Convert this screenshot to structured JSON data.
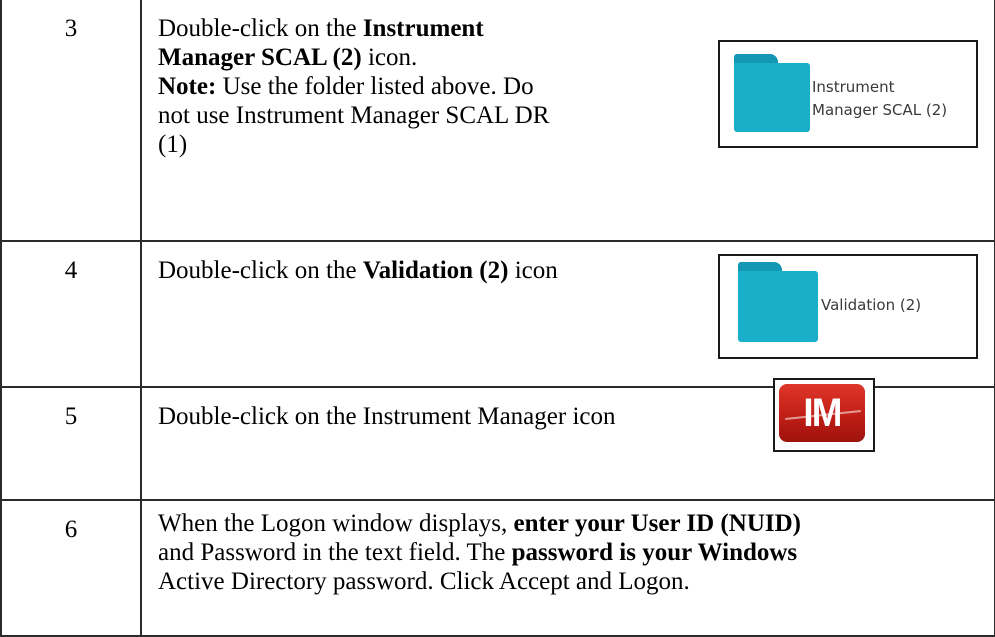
{
  "steps": [
    {
      "number": "3",
      "line1_pre": "Double-click on the ",
      "line1_bold": "Instrument",
      "line2_bold": "Manager SCAL (2)",
      "line2_post": " icon.",
      "note_label": "Note:",
      "note_line1": " Use the folder listed above.  Do",
      "note_line2": "not use Instrument Manager SCAL DR",
      "note_line3": "(1)",
      "image": {
        "icon": "folder-icon",
        "caption_line1": "Instrument",
        "caption_line2": "Manager SCAL (2)"
      }
    },
    {
      "number": "4",
      "text_pre": "Double-click on the ",
      "text_bold": "Validation (2)",
      "text_post": " icon",
      "image": {
        "icon": "folder-icon",
        "caption": "Validation (2)"
      }
    },
    {
      "number": "5",
      "text": "Double-click on the Instrument Manager icon",
      "image": {
        "icon": "instrument-manager-app-icon",
        "letters": "IM"
      }
    },
    {
      "number": "6",
      "line1_pre": "When the Logon window displays, ",
      "line1_bold": "enter your User ID (NUID)",
      "line2_pre": "and Password in the text field.  The ",
      "line2_bold": "password is your Windows",
      "line3": "Active Directory password.  Click Accept and Logon."
    }
  ],
  "colors": {
    "folder_front": "#19afc8",
    "folder_tab": "#1397b3",
    "im_red": "#c01e16"
  }
}
